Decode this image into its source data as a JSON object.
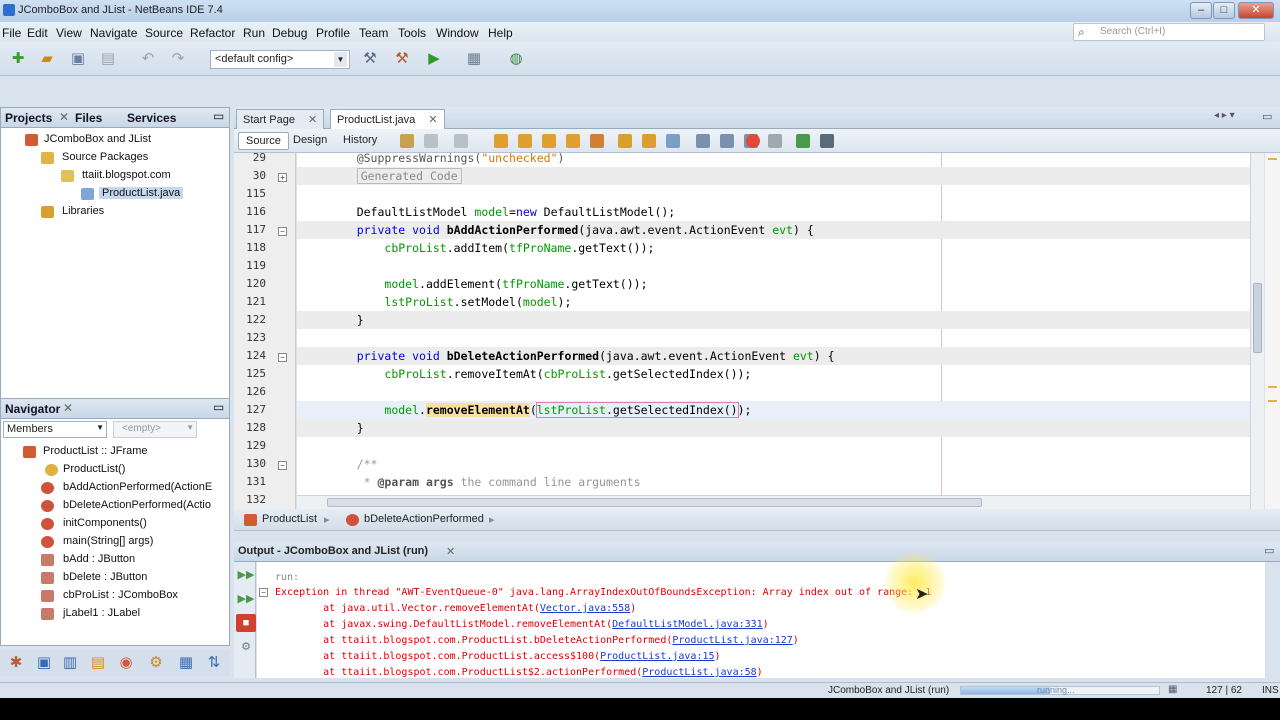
{
  "window": {
    "title": "JComboBox and JList - NetBeans IDE 7.4",
    "min": "–",
    "max": "□",
    "close": "✕"
  },
  "menu": [
    "File",
    "Edit",
    "View",
    "Navigate",
    "Source",
    "Refactor",
    "Run",
    "Debug",
    "Profile",
    "Team",
    "Tools",
    "Window",
    "Help"
  ],
  "search": {
    "placeholder": "Search (Ctrl+I)"
  },
  "toolbar": {
    "config": "<default config>"
  },
  "projects": {
    "tabs": [
      "Projects",
      "Files",
      "Services"
    ],
    "tree": [
      "JComboBox and JList",
      "Source Packages",
      "ttaiit.blogspot.com",
      "ProductList.java",
      "Libraries"
    ]
  },
  "navigator": {
    "title": "Navigator",
    "members": "Members",
    "empty": "<empty>",
    "items": [
      "ProductList :: JFrame",
      "ProductList()",
      "bAddActionPerformed(ActionE",
      "bDeleteActionPerformed(Actio",
      "initComponents()",
      "main(String[] args)",
      "bAdd : JButton",
      "bDelete : JButton",
      "cbProList : JComboBox",
      "jLabel1 : JLabel"
    ]
  },
  "editor": {
    "tabs": [
      "Start Page",
      "ProductList.java"
    ],
    "views": [
      "Source",
      "Design",
      "History"
    ],
    "lines": [
      {
        "n": "29",
        "code": "    @SuppressWarnings(\"unchecked\")"
      },
      {
        "n": "30",
        "code": "    Generated Code"
      },
      {
        "n": "115",
        "code": ""
      },
      {
        "n": "116",
        "code": "    DefaultListModel model=new DefaultListModel();"
      },
      {
        "n": "117",
        "code": "    private void bAddActionPerformed(java.awt.event.ActionEvent evt) {"
      },
      {
        "n": "118",
        "code": "        cbProList.addItem(tfProName.getText());"
      },
      {
        "n": "119",
        "code": ""
      },
      {
        "n": "120",
        "code": "        model.addElement(tfProName.getText());"
      },
      {
        "n": "121",
        "code": "        lstProList.setModel(model);"
      },
      {
        "n": "122",
        "code": "    }"
      },
      {
        "n": "123",
        "code": ""
      },
      {
        "n": "124",
        "code": "    private void bDeleteActionPerformed(java.awt.event.ActionEvent evt) {"
      },
      {
        "n": "125",
        "code": "        cbProList.removeItemAt(cbProList.getSelectedIndex());"
      },
      {
        "n": "126",
        "code": ""
      },
      {
        "n": "127",
        "code": "        model.removeElementAt(lstProList.getSelectedIndex());"
      },
      {
        "n": "128",
        "code": "    }"
      },
      {
        "n": "129",
        "code": ""
      },
      {
        "n": "130",
        "code": "    /**"
      },
      {
        "n": "131",
        "code": "     * @param args the command line arguments"
      },
      {
        "n": "132",
        "code": "     */"
      }
    ],
    "breadcrumbs": [
      "ProductList",
      "bDeleteActionPerformed"
    ]
  },
  "output": {
    "title": "Output - JComboBox and JList (run)",
    "run": "run:",
    "exception": "Exception in thread \"AWT-EventQueue-0\" java.lang.ArrayIndexOutOfBoundsException: Array index out of range: -1",
    "trace": [
      {
        "pre": "        at java.util.Vector.removeElementAt(",
        "link": "Vector.java:558",
        "post": ")"
      },
      {
        "pre": "        at javax.swing.DefaultListModel.removeElementAt(",
        "link": "DefaultListModel.java:331",
        "post": ")"
      },
      {
        "pre": "        at ttaiit.blogspot.com.ProductList.bDeleteActionPerformed(",
        "link": "ProductList.java:127",
        "post": ")"
      },
      {
        "pre": "        at ttaiit.blogspot.com.ProductList.access$100(",
        "link": "ProductList.java:15",
        "post": ")"
      },
      {
        "pre": "        at ttaiit.blogspot.com.ProductList$2.actionPerformed(",
        "link": "ProductList.java:58",
        "post": ")"
      }
    ]
  },
  "status": {
    "task": "JComboBox and JList (run)",
    "progress_label": "running...",
    "progress": 0.45,
    "position": "127 | 62",
    "mode": "INS"
  }
}
